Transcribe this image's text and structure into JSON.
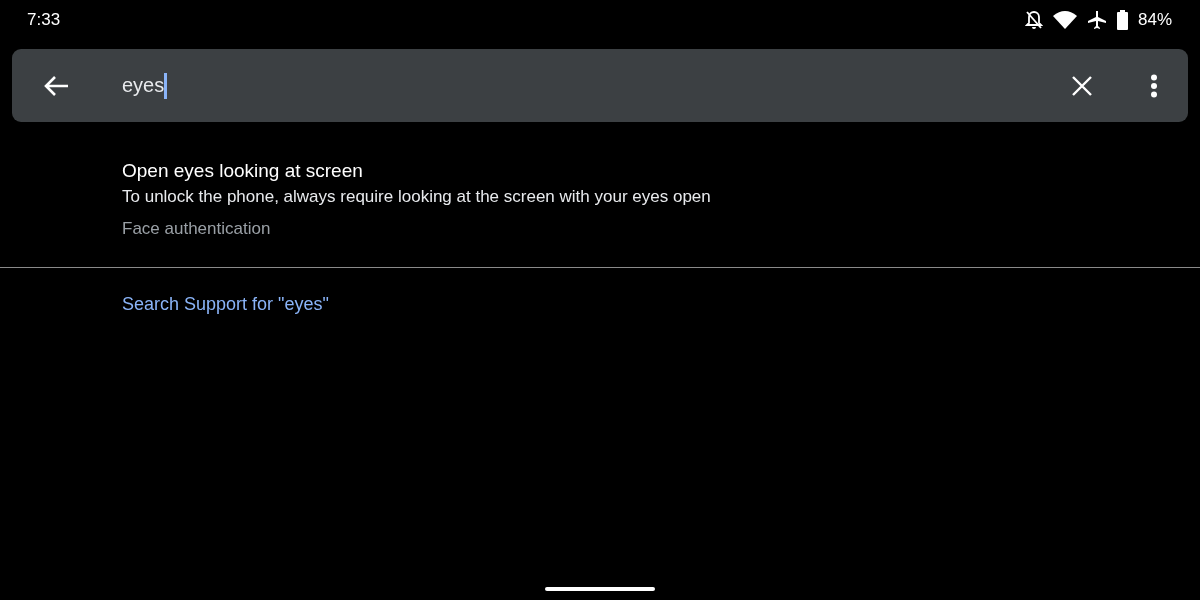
{
  "status_bar": {
    "time": "7:33",
    "battery": "84%"
  },
  "search": {
    "value": "eyes"
  },
  "results": [
    {
      "title": "Open eyes looking at screen",
      "summary": "To unlock the phone, always require looking at the screen with your eyes open",
      "category": "Face authentication"
    }
  ],
  "support_link": "Search Support for \"eyes\""
}
